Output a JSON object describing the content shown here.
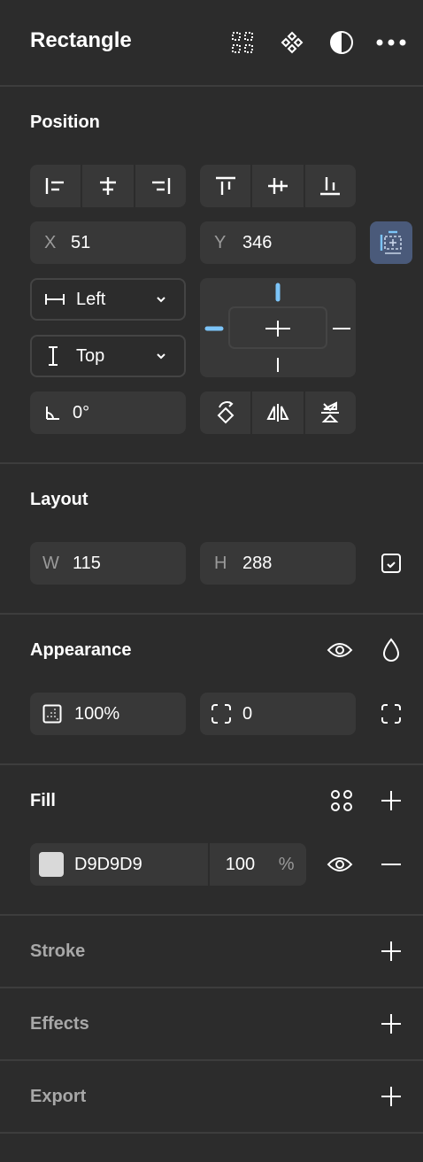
{
  "header": {
    "title": "Rectangle",
    "icons": [
      "grid-dots-icon",
      "component-icon",
      "contrast-icon",
      "more-icon"
    ]
  },
  "position": {
    "title": "Position",
    "x_label": "X",
    "x_value": "51",
    "y_label": "Y",
    "y_value": "346",
    "horizontal_constraint": "Left",
    "vertical_constraint": "Top",
    "rotation": "0°"
  },
  "layout": {
    "title": "Layout",
    "w_label": "W",
    "w_value": "115",
    "h_label": "H",
    "h_value": "288"
  },
  "appearance": {
    "title": "Appearance",
    "opacity": "100%",
    "corner_radius": "0"
  },
  "fill": {
    "title": "Fill",
    "hex": "D9D9D9",
    "swatch_color": "#d9d9d9",
    "opacity": "100",
    "percent": "%"
  },
  "stroke": {
    "title": "Stroke"
  },
  "effects": {
    "title": "Effects"
  },
  "export": {
    "title": "Export"
  },
  "colors": {
    "accent": "#7cc4f8",
    "active_bg": "#4a5a7a"
  }
}
